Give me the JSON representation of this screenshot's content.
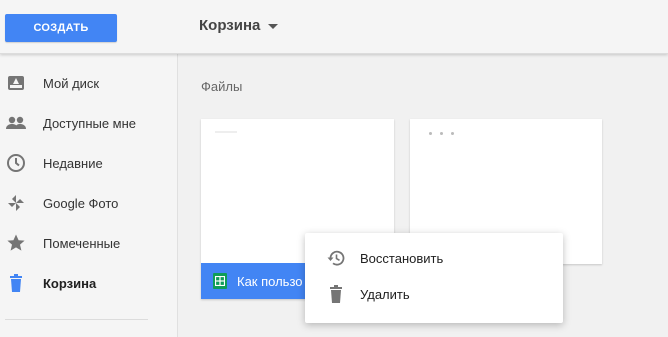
{
  "header": {
    "create_label": "СОЗДАТЬ",
    "location_title": "Корзина",
    "accent_color": "#4285f4"
  },
  "sidebar": {
    "items": [
      {
        "label": "Мой диск",
        "icon": "drive-icon"
      },
      {
        "label": "Доступные мне",
        "icon": "people-icon"
      },
      {
        "label": "Недавние",
        "icon": "clock-icon"
      },
      {
        "label": "Google Фото",
        "icon": "pinwheel-icon"
      },
      {
        "label": "Помеченные",
        "icon": "star-icon"
      },
      {
        "label": "Корзина",
        "icon": "trash-icon",
        "active": true
      }
    ]
  },
  "main": {
    "section_title": "Файлы",
    "files": [
      {
        "name": "Как пользо",
        "type": "spreadsheet",
        "icon": "sheets-icon",
        "selected": true
      },
      {
        "name": "",
        "type": "document"
      }
    ]
  },
  "context_menu": {
    "items": [
      {
        "label": "Восстановить",
        "icon": "restore-history-icon"
      },
      {
        "label": "Удалить",
        "icon": "trash-icon"
      }
    ]
  }
}
